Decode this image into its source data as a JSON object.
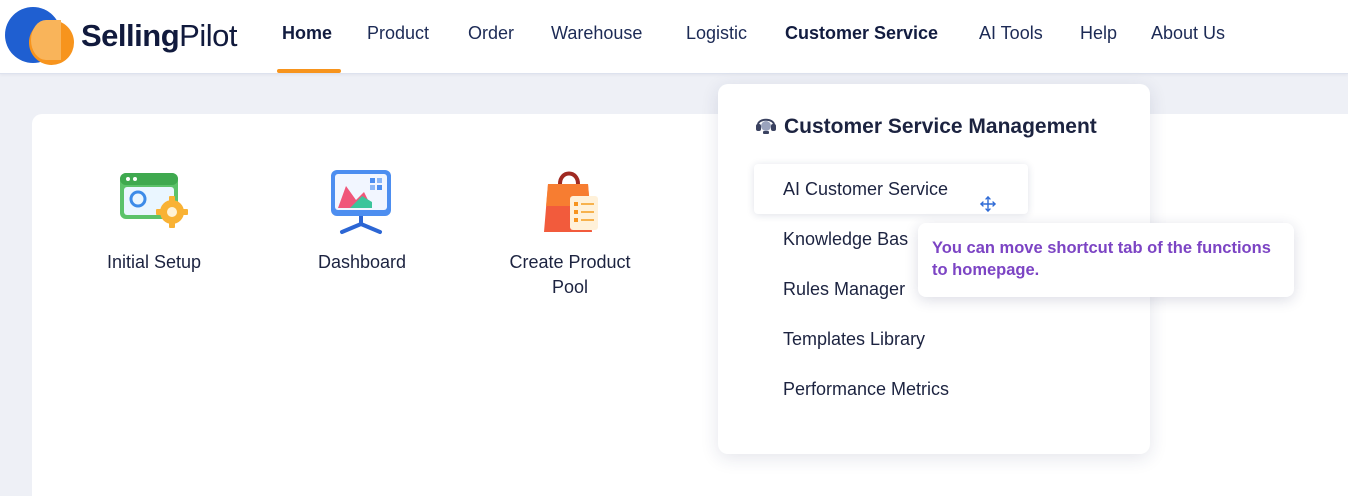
{
  "brand": {
    "name_bold": "Selling",
    "name_regular": "Pilot"
  },
  "nav": {
    "items": [
      {
        "label": "Home",
        "active": true
      },
      {
        "label": "Product"
      },
      {
        "label": "Order"
      },
      {
        "label": "Warehouse"
      },
      {
        "label": "Logistic"
      },
      {
        "label": "Customer Service",
        "highlighted": true
      },
      {
        "label": "AI Tools"
      },
      {
        "label": "Help"
      },
      {
        "label": "About Us"
      }
    ],
    "accent_color": "#f7941d"
  },
  "shortcuts": [
    {
      "label": "Initial Setup",
      "icon": "settings-window-icon"
    },
    {
      "label": "Dashboard",
      "icon": "presentation-board-icon"
    },
    {
      "label": "Create Product Pool",
      "icon": "shopping-bag-icon"
    }
  ],
  "dropdown": {
    "title": "Customer Service Management",
    "title_icon": "headset-icon",
    "items": [
      {
        "label": "AI Customer Service",
        "hovered": true
      },
      {
        "label": "Knowledge Bas"
      },
      {
        "label": "Rules Manager"
      },
      {
        "label": "Templates Library"
      },
      {
        "label": "Performance Metrics"
      }
    ]
  },
  "tooltip": {
    "text": "You can move shortcut tab of the functions to homepage.",
    "color": "#7c44c4"
  }
}
